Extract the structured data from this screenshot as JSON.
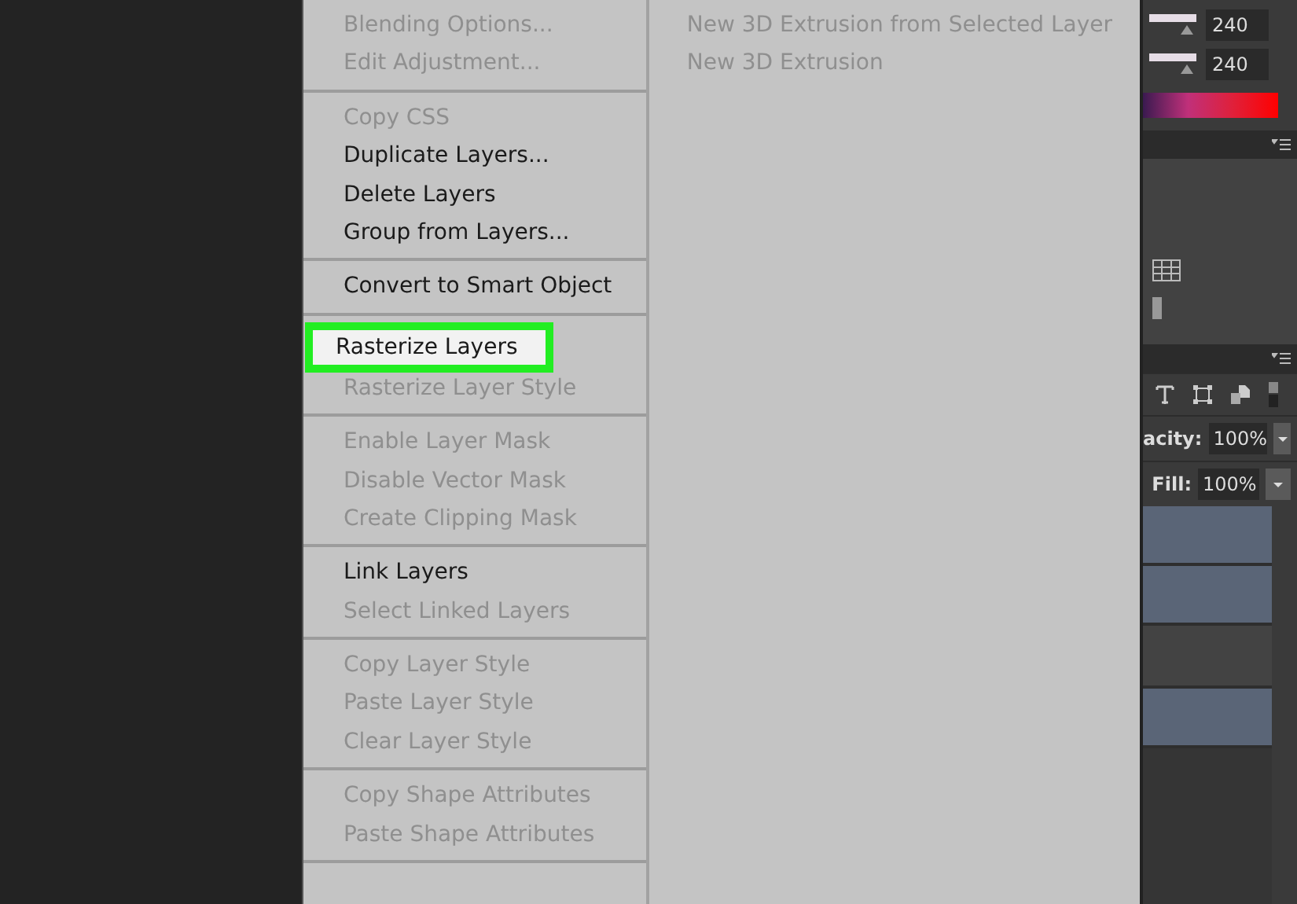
{
  "menu": {
    "groups": [
      {
        "items": [
          {
            "label": "Blending Options...",
            "disabled": true,
            "selected": false
          },
          {
            "label": "Edit Adjustment...",
            "disabled": true,
            "selected": false
          }
        ]
      },
      {
        "items": [
          {
            "label": "Copy CSS",
            "disabled": true,
            "selected": false
          },
          {
            "label": "Duplicate Layers...",
            "disabled": false,
            "selected": false
          },
          {
            "label": "Delete Layers",
            "disabled": false,
            "selected": false
          },
          {
            "label": "Group from Layers...",
            "disabled": false,
            "selected": false
          }
        ]
      },
      {
        "items": [
          {
            "label": "Convert to Smart Object",
            "disabled": false,
            "selected": false
          }
        ]
      },
      {
        "items": [
          {
            "label": "Rasterize Layers",
            "disabled": false,
            "selected": true
          },
          {
            "label": "Rasterize Layer Style",
            "disabled": true,
            "selected": false
          }
        ]
      },
      {
        "items": [
          {
            "label": "Enable Layer Mask",
            "disabled": true,
            "selected": false
          },
          {
            "label": "Disable Vector Mask",
            "disabled": true,
            "selected": false
          },
          {
            "label": "Create Clipping Mask",
            "disabled": true,
            "selected": false
          }
        ]
      },
      {
        "items": [
          {
            "label": "Link Layers",
            "disabled": false,
            "selected": false
          },
          {
            "label": "Select Linked Layers",
            "disabled": true,
            "selected": false
          }
        ]
      },
      {
        "items": [
          {
            "label": "Copy Layer Style",
            "disabled": true,
            "selected": false
          },
          {
            "label": "Paste Layer Style",
            "disabled": true,
            "selected": false
          },
          {
            "label": "Clear Layer Style",
            "disabled": true,
            "selected": false
          }
        ]
      },
      {
        "items": [
          {
            "label": "Copy Shape Attributes",
            "disabled": true,
            "selected": false
          },
          {
            "label": "Paste Shape Attributes",
            "disabled": true,
            "selected": false
          }
        ]
      }
    ]
  },
  "submenu": {
    "items": [
      {
        "label": "New 3D Extrusion from Selected Layer",
        "disabled": true
      },
      {
        "label": "New 3D Extrusion",
        "disabled": true
      }
    ]
  },
  "color_panel": {
    "fields": [
      "240",
      "240"
    ]
  },
  "layers_panel": {
    "opacity_label": "acity:",
    "opacity": "100%",
    "fill_label": "Fill:",
    "fill": "100%",
    "layers": [
      {
        "selected": true
      },
      {
        "selected": true
      },
      {
        "selected": false
      },
      {
        "selected": true
      }
    ]
  }
}
